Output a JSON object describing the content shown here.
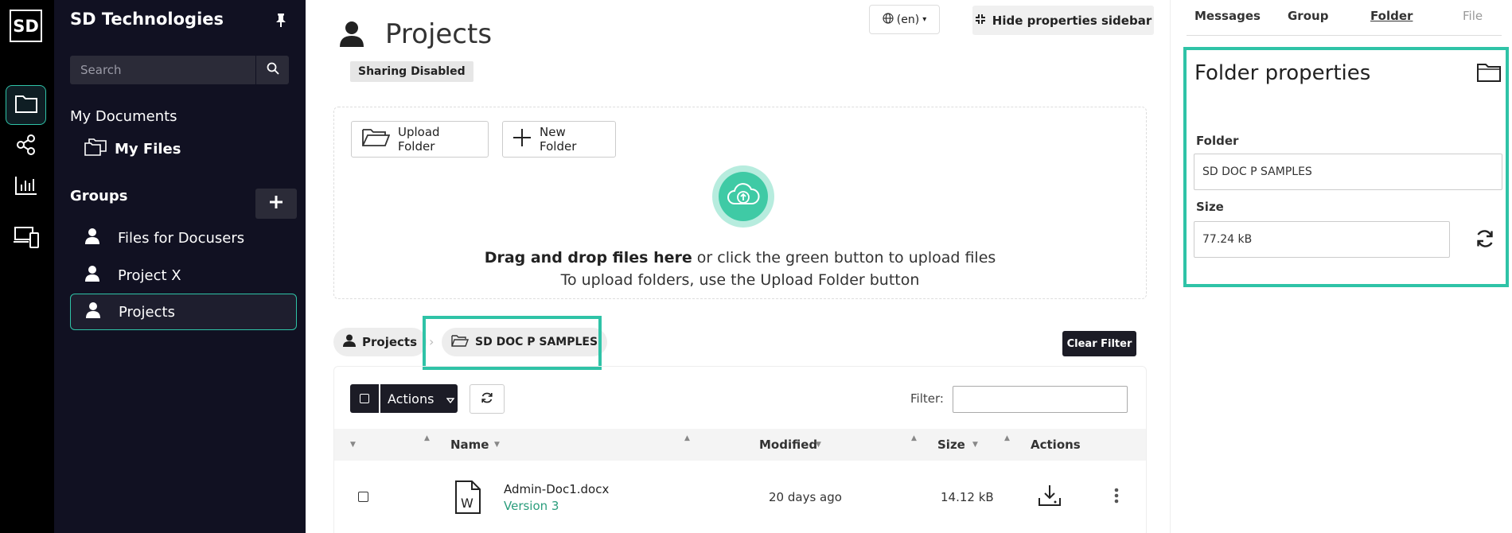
{
  "rail": {
    "logo": "SD",
    "items": [
      "folder-icon",
      "share-icon",
      "chart-icon",
      "devices-icon"
    ]
  },
  "sidebar": {
    "brand": "SD Technologies",
    "search_placeholder": "Search",
    "my_documents": "My Documents",
    "my_files": "My Files",
    "groups_heading": "Groups",
    "groups": [
      {
        "label": "Files for Docusers"
      },
      {
        "label": "Project X"
      },
      {
        "label": "Projects"
      }
    ]
  },
  "header": {
    "title": "Projects",
    "sharing_badge": "Sharing Disabled",
    "language": "(en)",
    "hide_sidebar": "Hide properties sidebar"
  },
  "dropzone": {
    "upload_folder": "Upload Folder",
    "new_folder": "New Folder",
    "drag_bold": "Drag and drop files here",
    "drag_rest": " or click the green button to upload files",
    "line2": "To upload folders, use the Upload Folder button"
  },
  "breadcrumb": {
    "root": "Projects",
    "current": "SD DOC P SAMPLES"
  },
  "clear_filter": "Clear Filter",
  "table": {
    "actions_label": "Actions",
    "filter_label": "Filter:",
    "columns": {
      "name": "Name",
      "modified": "Modified",
      "size": "Size",
      "actions": "Actions"
    },
    "rows": [
      {
        "name": "Admin-Doc1.docx",
        "version": "Version 3",
        "modified": "20 days ago",
        "size": "14.12 kB"
      }
    ]
  },
  "properties": {
    "tabs": [
      {
        "label": "Messages"
      },
      {
        "label": "Group"
      },
      {
        "label": "Folder"
      },
      {
        "label": "File"
      }
    ],
    "title": "Folder properties",
    "folder_label": "Folder",
    "folder_value": "SD DOC P SAMPLES",
    "size_label": "Size",
    "size_value": "77.24 kB"
  },
  "colors": {
    "accent": "#2fc3a7",
    "sidebar_bg": "#111122",
    "rail_bg": "#000000"
  }
}
